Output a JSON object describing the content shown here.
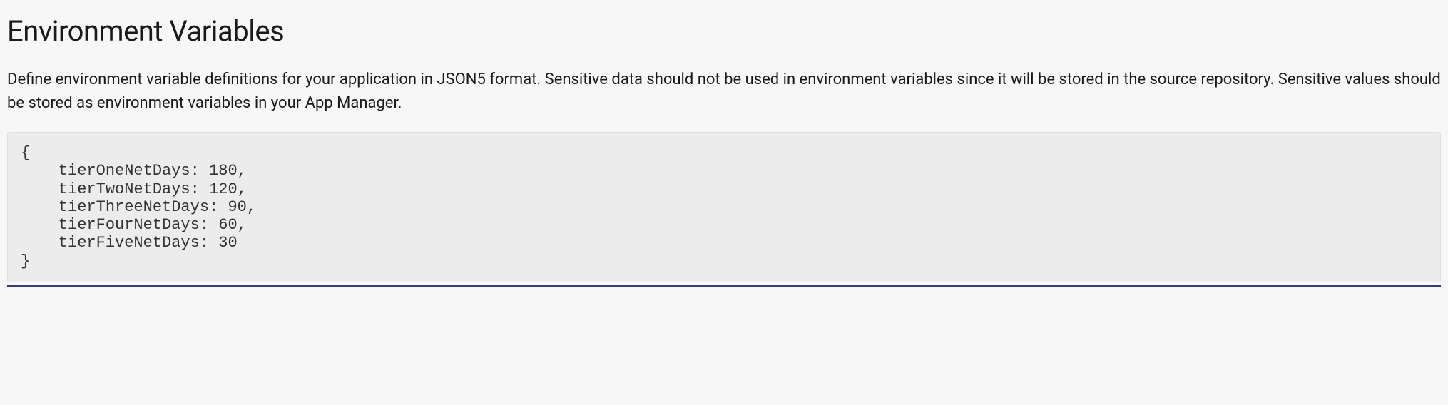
{
  "section": {
    "title": "Environment Variables",
    "description": "Define environment variable definitions for your application in JSON5 format. Sensitive data should not be used in environment variables since it will be stored in the source repository. Sensitive values should be stored as environment variables in your App Manager.",
    "code": "{\n    tierOneNetDays: 180,\n    tierTwoNetDays: 120,\n    tierThreeNetDays: 90,\n    tierFourNetDays: 60,\n    tierFiveNetDays: 30\n}"
  }
}
